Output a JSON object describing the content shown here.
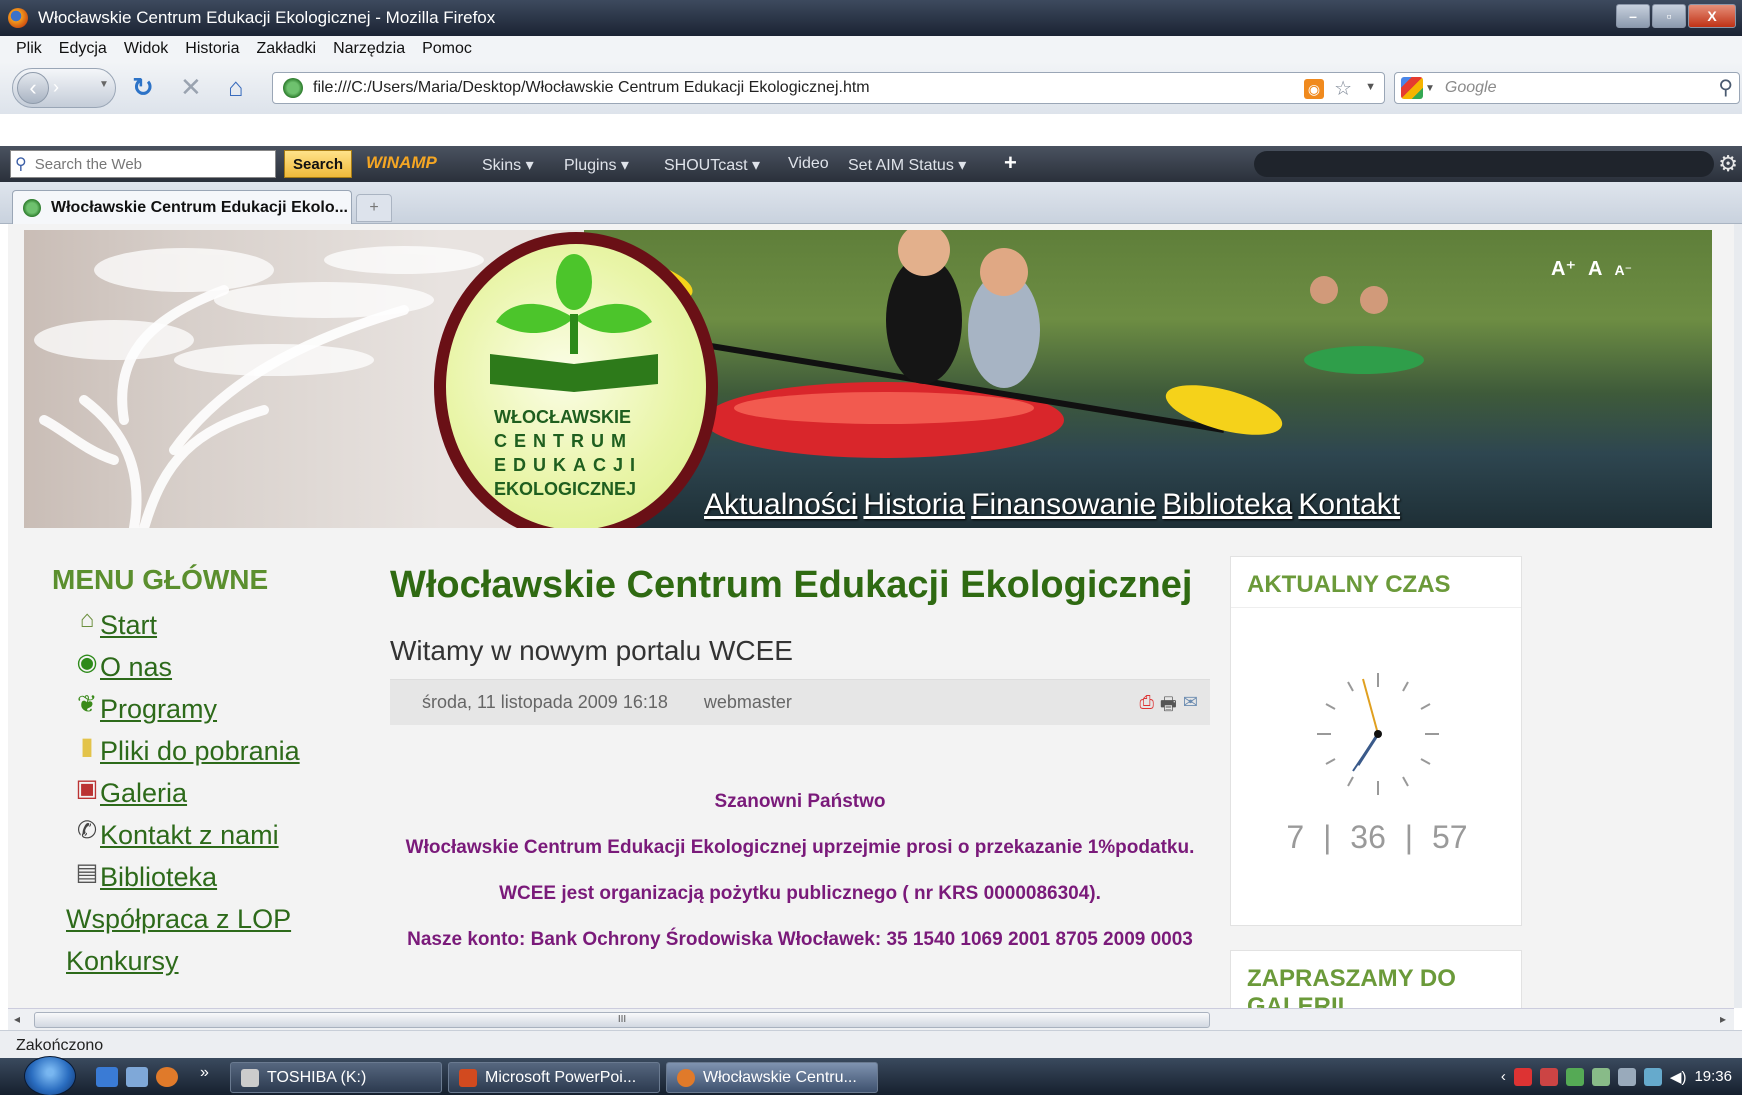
{
  "window": {
    "title": "Włocławskie Centrum Edukacji Ekologicznej - Mozilla Firefox",
    "controls": {
      "minimize": "–",
      "maximize": "▫",
      "close": "X"
    }
  },
  "menubar": [
    "Plik",
    "Edycja",
    "Widok",
    "Historia",
    "Zakładki",
    "Narzędzia",
    "Pomoc"
  ],
  "navbar": {
    "url": "file:///C:/Users/Maria/Desktop/Włocławskie Centrum Edukacji Ekologicznej.htm",
    "search_placeholder": "Google"
  },
  "winamp_toolbar": {
    "search_placeholder": "Search the Web",
    "search_button": "Search",
    "logo": "WINAMP",
    "items": [
      "Skins ▾",
      "Plugins ▾",
      "SHOUTcast ▾",
      "Video",
      "Set AIM Status ▾"
    ]
  },
  "tabs": {
    "active": "Włocławskie Centrum Edukacji Ekolo...",
    "new_tab": "+"
  },
  "banner": {
    "logo_lines": [
      "WŁOCŁAWSKIE",
      "CENTRUM",
      "EDUKACJI",
      "EKOLOGICZNEJ"
    ],
    "font_controls": [
      "A⁺",
      "A",
      "A⁻"
    ],
    "topnav": [
      "Aktualności",
      "Historia",
      "Finansowanie",
      "Biblioteka",
      "Kontakt"
    ]
  },
  "sidebar_left": {
    "heading": "MENU GŁÓWNE",
    "items": [
      {
        "label": "Start",
        "icon": "home-icon"
      },
      {
        "label": "O nas",
        "icon": "logo-icon"
      },
      {
        "label": "Programy",
        "icon": "leaf-icon"
      },
      {
        "label": "Pliki do pobrania",
        "icon": "file-icon"
      },
      {
        "label": "Galeria",
        "icon": "gallery-icon"
      },
      {
        "label": "Kontakt z nami",
        "icon": "phone-icon"
      },
      {
        "label": "Biblioteka",
        "icon": "book-icon"
      },
      {
        "label": "Współpraca z LOP",
        "icon": ""
      },
      {
        "label": "Konkursy",
        "icon": ""
      }
    ]
  },
  "main": {
    "title": "Włocławskie Centrum Edukacji Ekologicznej",
    "subtitle": "Witamy w nowym portalu WCEE",
    "date": "środa, 11 listopada 2009 16:18",
    "author": "webmaster",
    "paragraphs": [
      "Szanowni Państwo",
      "Włocławskie Centrum Edukacji Ekologicznej uprzejmie prosi o przekazanie 1%podatku.",
      "WCEE jest organizacją pożytku publicznego ( nr KRS 0000086304).",
      "Nasze konto: Bank Ochrony Środowiska Włocławek: 35 1540 1069 2001 8705 2009 0003"
    ]
  },
  "sidebar_right": {
    "clock_heading": "AKTUALNY CZAS",
    "clock_digits": {
      "h": "7",
      "m": "36",
      "s": "57",
      "sep": "|"
    },
    "gallery_heading": "ZAPRASZAMY DO GALERII"
  },
  "hscroll": {
    "grip": "III"
  },
  "statusbar": "Zakończono",
  "taskbar": {
    "tasks": [
      "TOSHIBA (K:)",
      "Microsoft PowerPoi...",
      "Włocławskie Centru..."
    ],
    "chevron": "»",
    "time": "19:36"
  }
}
